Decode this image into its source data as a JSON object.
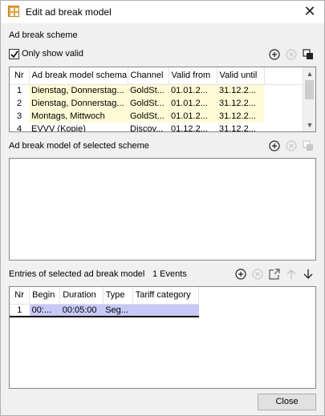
{
  "window": {
    "title": "Edit ad break model",
    "close_glyph": "✕"
  },
  "scheme": {
    "section_label": "Ad break scheme",
    "only_show_valid_label": "Only show valid",
    "only_show_valid_checked": true,
    "columns": [
      "Nr",
      "Ad break model schema",
      "Channel",
      "Valid from",
      "Valid until"
    ],
    "rows": [
      {
        "nr": "1",
        "schema": "Dienstag, Donnerstag...",
        "channel": "GoldSt...",
        "from": "01.01.2...",
        "until": "31.12.2..."
      },
      {
        "nr": "2",
        "schema": "Dienstag, Donnerstag...",
        "channel": "GoldSt...",
        "from": "01.01.2...",
        "until": "31.12.2..."
      },
      {
        "nr": "3",
        "schema": "Montags, Mittwoch",
        "channel": "GoldSt...",
        "from": "01.01.2...",
        "until": "31.12.2..."
      },
      {
        "nr": "4",
        "schema": "EVVV (Kopie)",
        "channel": "Discov...",
        "from": "01.12.2...",
        "until": "31.12.2..."
      }
    ],
    "tools": {
      "add_icon": "add-icon",
      "remove_icon": "remove-icon",
      "copy_icon": "copy-icon"
    }
  },
  "model": {
    "section_label": "Ad break model of selected scheme"
  },
  "entries": {
    "section_label": "Entries of selected ad break model",
    "count_label": "1 Events",
    "columns": [
      "Nr",
      "Begin",
      "Duration",
      "Type",
      "Tariff category"
    ],
    "rows": [
      {
        "nr": "1",
        "begin": "00:...",
        "duration": "00:05:00",
        "type": "Seg...",
        "tariff": ""
      }
    ]
  },
  "footer": {
    "close_label": "Close"
  },
  "colors": {
    "row_highlight": "#fffbd6",
    "row_selected": "#c8c8f8",
    "accent_icon": "#e8a33a"
  }
}
